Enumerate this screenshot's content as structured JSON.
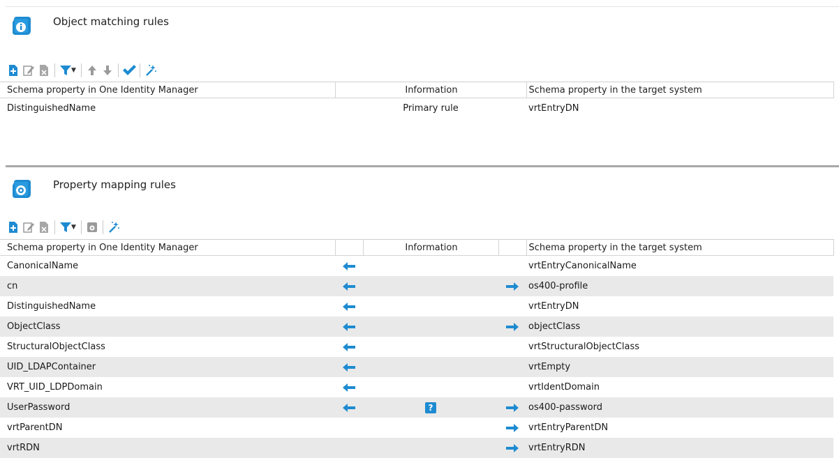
{
  "object_matching": {
    "title": "Object matching rules",
    "icon": "scroll-info-icon",
    "columns": [
      "Schema property in One Identity Manager",
      "Information",
      "Schema property in the target system"
    ],
    "rows": [
      {
        "left": "DistinguishedName",
        "info": "Primary rule",
        "right": "vrtEntryDN"
      }
    ]
  },
  "property_mapping": {
    "title": "Property mapping rules",
    "icon": "scroll-gear-icon",
    "columns": [
      "Schema property in One Identity Manager",
      "",
      "Information",
      "",
      "Schema property in the target system"
    ],
    "rows": [
      {
        "left": "CanonicalName",
        "arrow_left": true,
        "info": "",
        "arrow_right": false,
        "right": "vrtEntryCanonicalName"
      },
      {
        "left": "cn",
        "arrow_left": true,
        "info": "",
        "arrow_right": true,
        "right": "os400-profile"
      },
      {
        "left": "DistinguishedName",
        "arrow_left": true,
        "info": "",
        "arrow_right": false,
        "right": "vrtEntryDN"
      },
      {
        "left": "ObjectClass",
        "arrow_left": true,
        "info": "",
        "arrow_right": true,
        "right": "objectClass"
      },
      {
        "left": "StructuralObjectClass",
        "arrow_left": true,
        "info": "",
        "arrow_right": false,
        "right": "vrtStructuralObjectClass"
      },
      {
        "left": "UID_LDAPContainer",
        "arrow_left": true,
        "info": "",
        "arrow_right": false,
        "right": "vrtEmpty"
      },
      {
        "left": "VRT_UID_LDPDomain",
        "arrow_left": true,
        "info": "",
        "arrow_right": false,
        "right": "vrtIdentDomain"
      },
      {
        "left": "UserPassword",
        "arrow_left": true,
        "info": "?",
        "arrow_right": true,
        "right": "os400-password"
      },
      {
        "left": "vrtParentDN",
        "arrow_left": false,
        "info": "",
        "arrow_right": true,
        "right": "vrtEntryParentDN"
      },
      {
        "left": "vrtRDN",
        "arrow_left": false,
        "info": "",
        "arrow_right": true,
        "right": "vrtEntryRDN"
      }
    ]
  },
  "colors": {
    "accent": "#1e8bd1",
    "row_alt": "#e9e9e9",
    "separator": "#a8a8a8"
  }
}
